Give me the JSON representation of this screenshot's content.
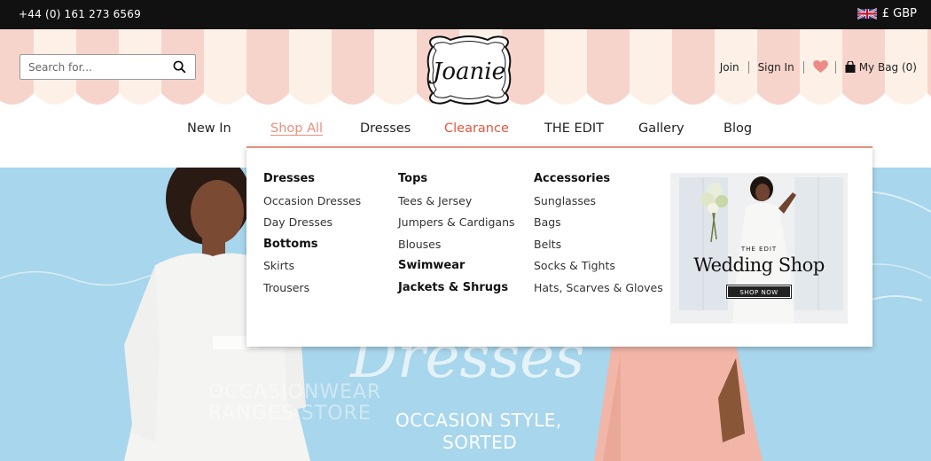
{
  "topbar": {
    "phone": "+44 (0) 161 273 6569",
    "currency": "£ GBP"
  },
  "header": {
    "search_placeholder": "Search for...",
    "logo_text": "Joanie",
    "join": "Join",
    "sign_in": "Sign In",
    "bag": "My Bag (0)"
  },
  "nav": {
    "items": [
      "New In",
      "Shop All",
      "Dresses",
      "Clearance",
      "THE EDIT",
      "Gallery",
      "Blog"
    ],
    "active": "Shop All",
    "sale": "Clearance"
  },
  "dropdown": {
    "col1": {
      "heading1": "Dresses",
      "items1": [
        "Occasion Dresses",
        "Day Dresses"
      ],
      "heading2": "Bottoms",
      "items2": [
        "Skirts",
        "Trousers"
      ]
    },
    "col2": {
      "heading1": "Tops",
      "items1": [
        "Tees & Jersey",
        "Jumpers & Cardigans",
        "Blouses"
      ],
      "heading2": "Swimwear",
      "heading3": "Jackets & Shrugs"
    },
    "col3": {
      "heading": "Accessories",
      "items": [
        "Sunglasses",
        "Bags",
        "Belts",
        "Socks & Tights",
        "Hats, Scarves & Gloves"
      ]
    },
    "promo": {
      "tagline": "THE EDIT",
      "title": "Wedding Shop",
      "button": "SHOP NOW"
    }
  },
  "hero": {
    "script": "Dresses",
    "ghost_line1": "OCCASIONWEAR",
    "ghost_line2": "RANGES STORE",
    "tagline_line1": "OCCASION STYLE,",
    "tagline_line2": "SORTED"
  },
  "colors": {
    "accent": "#e8907d",
    "sale": "#e2573f",
    "hero_bg": "#a8d6ec",
    "awning_stripe": "#f7d4cb",
    "awning_alt": "#fdf1e7"
  }
}
